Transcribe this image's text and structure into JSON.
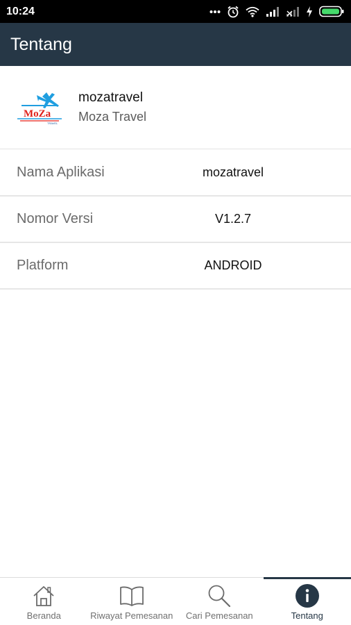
{
  "status_bar": {
    "time": "10:24",
    "icons": [
      "more-dots-icon",
      "alarm-icon",
      "wifi-icon",
      "signal-icon",
      "no-signal-icon",
      "charging-icon",
      "battery-icon"
    ]
  },
  "app_bar": {
    "title": "Tentang"
  },
  "app_header": {
    "logo_text": "MoZa",
    "logo_subtext": "TRAVEL",
    "name": "mozatravel",
    "subtitle": "Moza Travel"
  },
  "info": [
    {
      "label": "Nama Aplikasi",
      "value": "mozatravel"
    },
    {
      "label": "Nomor Versi",
      "value": "V1.2.7"
    },
    {
      "label": "Platform",
      "value": "ANDROID"
    }
  ],
  "bottom_nav": [
    {
      "label": "Beranda",
      "icon": "home-icon",
      "active": false
    },
    {
      "label": "Riwayat Pemesanan",
      "icon": "book-icon",
      "active": false
    },
    {
      "label": "Cari Pemesanan",
      "icon": "search-icon",
      "active": false
    },
    {
      "label": "Tentang",
      "icon": "info-icon",
      "active": true
    }
  ],
  "colors": {
    "app_bar": "#263746",
    "status_bar": "#000000",
    "logo_red": "#e0201b",
    "logo_blue": "#1f9ee0"
  }
}
